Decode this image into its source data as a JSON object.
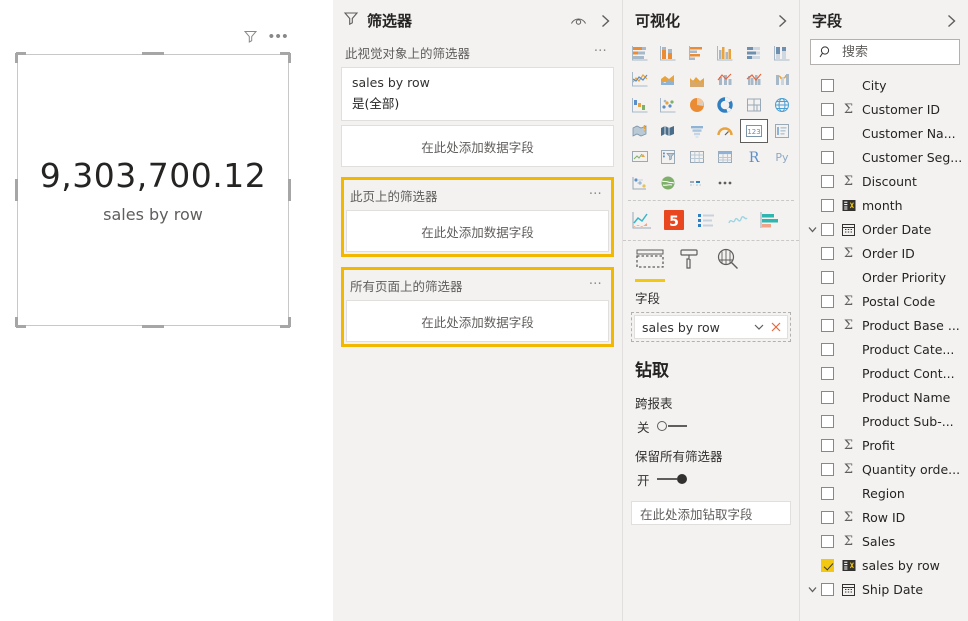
{
  "canvas": {
    "visual": {
      "value": "9,303,700.12",
      "label": "sales by row",
      "filter_icon": "filter-icon",
      "more_icon": "more-options-icon"
    }
  },
  "filters_pane": {
    "title": "筛选器",
    "title_icon": "filter-icon",
    "hide_icon": "eye-icon",
    "collapse_icon": "chevron-right-icon",
    "groups": [
      {
        "heading": "此视觉对象上的筛选器",
        "highlighted": true,
        "card": {
          "field": "sales by row",
          "value": "是(全部)"
        },
        "dropzone": "在此处添加数据字段",
        "dropzone_outside": true
      },
      {
        "heading": "此页上的筛选器",
        "highlighted": true,
        "dropzone": "在此处添加数据字段"
      },
      {
        "heading": "所有页面上的筛选器",
        "highlighted": true,
        "dropzone": "在此处添加数据字段"
      }
    ],
    "menu_dots": "…"
  },
  "viz_pane": {
    "title": "可视化",
    "collapse_icon": "chevron-right-icon",
    "gallery": [
      {
        "name": "stacked-bar-chart-icon",
        "selected": false
      },
      {
        "name": "stacked-column-chart-icon",
        "selected": false
      },
      {
        "name": "clustered-bar-chart-icon",
        "selected": false
      },
      {
        "name": "clustered-column-chart-icon",
        "selected": false
      },
      {
        "name": "100-percent-stacked-bar-chart-icon",
        "selected": false
      },
      {
        "name": "100-percent-stacked-column-chart-icon",
        "selected": false
      },
      {
        "name": "line-chart-icon",
        "selected": false
      },
      {
        "name": "area-chart-icon",
        "selected": false
      },
      {
        "name": "stacked-area-chart-icon",
        "selected": false
      },
      {
        "name": "line-and-stacked-column-chart-icon",
        "selected": false
      },
      {
        "name": "line-and-clustered-column-chart-icon",
        "selected": false
      },
      {
        "name": "ribbon-chart-icon",
        "selected": false
      },
      {
        "name": "waterfall-chart-icon",
        "selected": false
      },
      {
        "name": "scatter-chart-icon",
        "selected": false
      },
      {
        "name": "pie-chart-icon",
        "selected": false
      },
      {
        "name": "donut-chart-icon",
        "selected": false
      },
      {
        "name": "treemap-icon",
        "selected": false
      },
      {
        "name": "map-icon",
        "selected": false
      },
      {
        "name": "filled-map-icon",
        "selected": false
      },
      {
        "name": "shape-map-icon",
        "selected": false
      },
      {
        "name": "funnel-chart-icon",
        "selected": false
      },
      {
        "name": "gauge-chart-icon",
        "selected": false
      },
      {
        "name": "card-icon",
        "selected": true
      },
      {
        "name": "multi-row-card-icon",
        "selected": false
      },
      {
        "name": "kpi-icon",
        "selected": false
      },
      {
        "name": "slicer-icon",
        "selected": false
      },
      {
        "name": "table-icon",
        "selected": false
      },
      {
        "name": "matrix-icon",
        "selected": false
      },
      {
        "name": "r-script-visual-icon",
        "selected": false
      },
      {
        "name": "python-visual-icon",
        "selected": false
      },
      {
        "name": "key-influencers-icon",
        "selected": false
      },
      {
        "name": "arcgis-maps-icon",
        "selected": false
      },
      {
        "name": "paginated-report-icon",
        "selected": false
      },
      {
        "name": "get-more-visuals-icon",
        "selected": false
      }
    ],
    "custom_visuals": [
      {
        "name": "custom-line-area-visual-icon"
      },
      {
        "name": "html5-visual-icon"
      },
      {
        "name": "custom-list-visual-icon"
      },
      {
        "name": "custom-sparkline-visual-icon"
      },
      {
        "name": "custom-bar-visual-icon"
      }
    ],
    "tabs": [
      {
        "name": "fields-tab-icon",
        "active": true
      },
      {
        "name": "format-tab-icon",
        "active": false
      },
      {
        "name": "analytics-tab-icon",
        "active": false
      }
    ],
    "fields_section_label": "字段",
    "field_well": {
      "value": "sales by row",
      "dropdown_icon": "chevron-down-icon",
      "remove_icon": "close-icon"
    },
    "drill": {
      "title": "钻取",
      "cross_report_label": "跨报表",
      "cross_report_state": "关",
      "cross_report_on": false,
      "keep_all_filters_label": "保留所有筛选器",
      "keep_all_filters_state": "开",
      "keep_all_filters_on": true,
      "drill_dropzone": "在此处添加钻取字段"
    }
  },
  "fields_pane": {
    "title": "字段",
    "collapse_icon": "chevron-right-icon",
    "search": {
      "placeholder": "搜索",
      "value": "",
      "icon": "search-icon"
    },
    "fields": [
      {
        "label": "City",
        "icon": "none",
        "checked": false,
        "expandable": false
      },
      {
        "label": "Customer ID",
        "icon": "sigma",
        "checked": false,
        "expandable": false
      },
      {
        "label": "Customer Na...",
        "icon": "none",
        "checked": false,
        "expandable": false
      },
      {
        "label": "Customer Seg...",
        "icon": "none",
        "checked": false,
        "expandable": false
      },
      {
        "label": "Discount",
        "icon": "sigma",
        "checked": false,
        "expandable": false
      },
      {
        "label": "month",
        "icon": "calculated-table-icon",
        "checked": false,
        "expandable": false
      },
      {
        "label": "Order Date",
        "icon": "calendar-icon",
        "checked": false,
        "expandable": true
      },
      {
        "label": "Order ID",
        "icon": "sigma",
        "checked": false,
        "expandable": false
      },
      {
        "label": "Order Priority",
        "icon": "none",
        "checked": false,
        "expandable": false
      },
      {
        "label": "Postal Code",
        "icon": "sigma",
        "checked": false,
        "expandable": false
      },
      {
        "label": "Product Base ...",
        "icon": "sigma",
        "checked": false,
        "expandable": false
      },
      {
        "label": "Product Cate...",
        "icon": "none",
        "checked": false,
        "expandable": false
      },
      {
        "label": "Product Cont...",
        "icon": "none",
        "checked": false,
        "expandable": false
      },
      {
        "label": "Product Name",
        "icon": "none",
        "checked": false,
        "expandable": false
      },
      {
        "label": "Product Sub-...",
        "icon": "none",
        "checked": false,
        "expandable": false
      },
      {
        "label": "Profit",
        "icon": "sigma",
        "checked": false,
        "expandable": false
      },
      {
        "label": "Quantity orde...",
        "icon": "sigma",
        "checked": false,
        "expandable": false
      },
      {
        "label": "Region",
        "icon": "none",
        "checked": false,
        "expandable": false
      },
      {
        "label": "Row ID",
        "icon": "sigma",
        "checked": false,
        "expandable": false
      },
      {
        "label": "Sales",
        "icon": "sigma",
        "checked": false,
        "expandable": false
      },
      {
        "label": "sales by row",
        "icon": "calculated-table-icon",
        "checked": true,
        "expandable": false
      },
      {
        "label": "Ship Date",
        "icon": "calendar-icon",
        "checked": false,
        "expandable": true
      }
    ]
  },
  "colors": {
    "accent_yellow": "#F2C811",
    "highlight_border": "#F2B701",
    "panel_bg": "#F3F2F1",
    "text_primary": "#252423",
    "text_secondary": "#605E5C"
  }
}
